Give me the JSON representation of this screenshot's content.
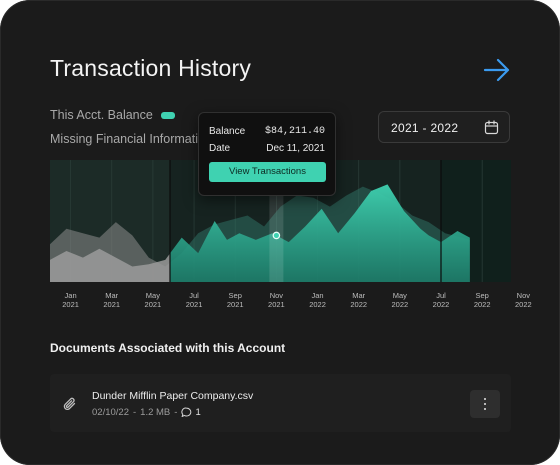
{
  "title": "Transaction History",
  "legend": {
    "balance_label": "This Acct. Balance",
    "missing_label": "Missing Financial Information"
  },
  "date_range": "2021 - 2022",
  "tooltip": {
    "balance_label": "Balance",
    "balance_value": "$84,211.40",
    "date_label": "Date",
    "date_value": "Dec 11, 2021",
    "button_label": "View Transactions"
  },
  "colors": {
    "accent": "#3fd2b1",
    "arrow": "#3b9bf0",
    "missing": "#8a8a8a"
  },
  "chart_data": {
    "type": "area",
    "x_ticks": [
      {
        "month": "Jan",
        "year": "2021"
      },
      {
        "month": "Mar",
        "year": "2021"
      },
      {
        "month": "May",
        "year": "2021"
      },
      {
        "month": "Jul",
        "year": "2021"
      },
      {
        "month": "Sep",
        "year": "2021"
      },
      {
        "month": "Nov",
        "year": "2021"
      },
      {
        "month": "Jan",
        "year": "2022"
      },
      {
        "month": "Mar",
        "year": "2022"
      },
      {
        "month": "May",
        "year": "2022"
      },
      {
        "month": "Jul",
        "year": "2022"
      },
      {
        "month": "Sep",
        "year": "2022"
      },
      {
        "month": "Nov",
        "year": "2022"
      }
    ],
    "series": [
      {
        "name": "This Acct. Balance",
        "role": "balance",
        "x": [
          0.0,
          0.4,
          0.8,
          1.2,
          1.6,
          2.0,
          2.4,
          2.8,
          3.2,
          3.6,
          4.0,
          4.3,
          4.6,
          5.0,
          5.4,
          5.8,
          6.2,
          6.6,
          7.0,
          7.4,
          7.8,
          8.2,
          8.6,
          9.0,
          9.2,
          9.5,
          9.9,
          10.2
        ],
        "y": [
          20,
          28,
          22,
          30,
          22,
          14,
          16,
          20,
          40,
          26,
          55,
          38,
          44,
          38,
          44,
          36,
          50,
          66,
          44,
          62,
          82,
          88,
          64,
          48,
          42,
          36,
          46,
          40
        ]
      },
      {
        "name": "Missing Financial Information",
        "role": "missing",
        "x": [
          0.0,
          0.4,
          0.8,
          1.2,
          1.6,
          2.0,
          2.4,
          2.8,
          3.2,
          3.6,
          4.0,
          4.4,
          4.8,
          5.2,
          5.6,
          6.0,
          6.4,
          6.8,
          7.2,
          7.6,
          8.0,
          8.4,
          8.8,
          9.2,
          9.6,
          10.0,
          10.2
        ],
        "y": [
          34,
          48,
          44,
          40,
          54,
          42,
          22,
          14,
          26,
          44,
          52,
          56,
          60,
          50,
          68,
          78,
          76,
          68,
          78,
          86,
          80,
          72,
          60,
          54,
          44,
          40,
          38
        ]
      }
    ],
    "tooltip_x": 5.5,
    "ylim": [
      0,
      110
    ],
    "xlim": [
      0,
      11.2
    ]
  },
  "documents": {
    "heading": "Documents Associated with this Account",
    "items": [
      {
        "name": "Dunder Mifflin Paper Company.csv",
        "date": "02/10/22",
        "size": "1.2 MB",
        "separator": "-",
        "comments": "1"
      }
    ]
  }
}
